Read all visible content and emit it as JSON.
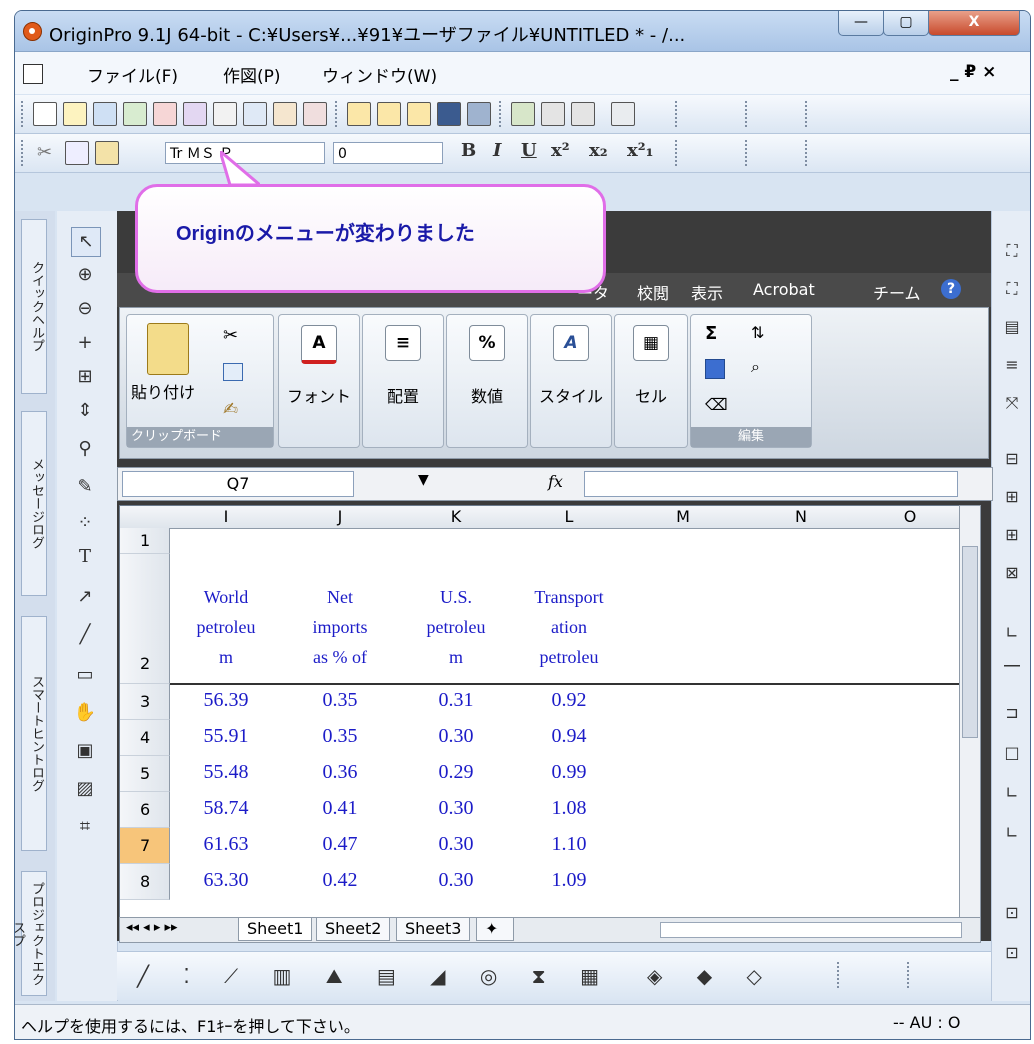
{
  "window": {
    "title": "OriginPro 9.1J 64-bit - C:¥Users¥...¥91¥ユーザファイル¥UNTITLED * - /...",
    "minimize": "—",
    "maximize": "▢",
    "close": "X"
  },
  "menu": {
    "items": [
      "ファイル(F)",
      "作図(P)",
      "ウィンドウ(W)"
    ],
    "mdi_controls": "_ ₽ ×"
  },
  "format_toolbar": {
    "font_box": "Tr  ＭＳ Ｐ",
    "size_box": "0",
    "bold": "B",
    "italic": "I",
    "underline": "U",
    "superscript": "x²",
    "subscript": "x₂",
    "supsub": "x²₁"
  },
  "side_tabs": [
    "クイックヘルプ",
    "メッセージログ",
    "スマートヒントログ",
    "プロジェクトエクスプ"
  ],
  "ribbon": {
    "tabs": [
      "ータ",
      "校閲",
      "表示",
      "Acrobat",
      "チーム"
    ],
    "groups": {
      "clipboard": {
        "paste": "貼り付け",
        "label": "クリップボード"
      },
      "font": {
        "icon": "A",
        "label": "フォント"
      },
      "align": {
        "icon": "≡",
        "label": "配置"
      },
      "number": {
        "icon": "%",
        "label": "数値"
      },
      "style": {
        "icon": "A",
        "label": "スタイル"
      },
      "cell": {
        "icon": "▦",
        "label": "セル"
      },
      "edit": {
        "sum": "Σ",
        "label": "編集"
      }
    }
  },
  "formula_bar": {
    "name_box": "Q7",
    "fx": "fx"
  },
  "sheet": {
    "columns": [
      "I",
      "J",
      "K",
      "L",
      "M",
      "N",
      "O"
    ],
    "row_numbers": [
      "1",
      "2",
      "3",
      "4",
      "5",
      "6",
      "7",
      "8"
    ],
    "header_row": [
      [
        "World",
        "petroleu",
        "m"
      ],
      [
        "Net",
        "imports",
        "as % of"
      ],
      [
        "U.S.",
        "petroleu",
        "m"
      ],
      [
        "Transport",
        "ation",
        "petroleu"
      ]
    ],
    "rows": [
      [
        "56.39",
        "0.35",
        "0.31",
        "0.92"
      ],
      [
        "55.91",
        "0.35",
        "0.30",
        "0.94"
      ],
      [
        "55.48",
        "0.36",
        "0.29",
        "0.99"
      ],
      [
        "58.74",
        "0.41",
        "0.30",
        "1.08"
      ],
      [
        "61.63",
        "0.47",
        "0.30",
        "1.10"
      ],
      [
        "63.30",
        "0.42",
        "0.30",
        "1.09"
      ]
    ],
    "selected_row": "7",
    "tabs": [
      "Sheet1",
      "Sheet2",
      "Sheet3"
    ]
  },
  "callout": {
    "text": "Originのメニューが変わりました"
  },
  "status": {
    "help": "ヘルプを使用するには、F1ｷｰを押して下さい。",
    "right": "-- AU : O"
  },
  "colors": {
    "cell_text": "#1c1cc8",
    "callout_border": "#e06ee8",
    "callout_text": "#1a1aa8"
  }
}
